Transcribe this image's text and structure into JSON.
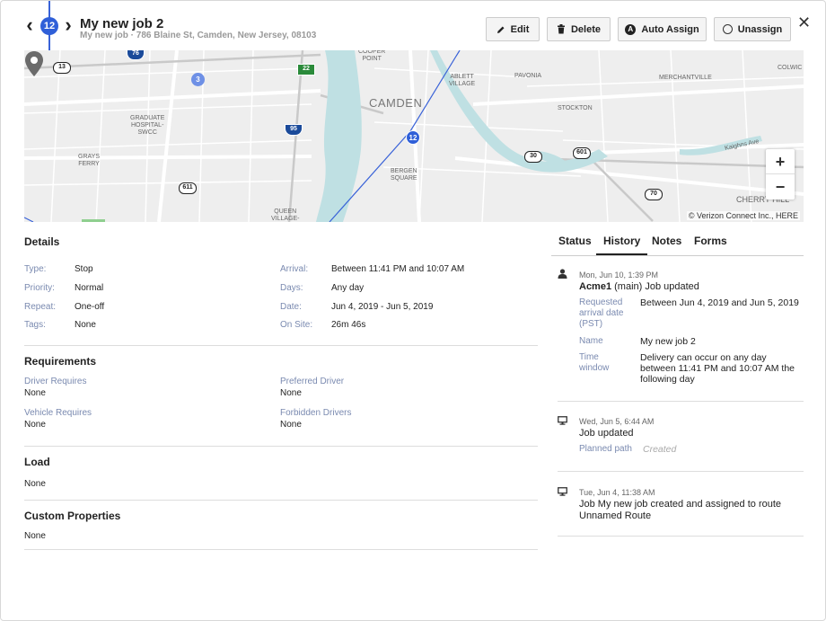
{
  "header": {
    "stop_number": "12",
    "title": "My new job 2",
    "subtitle": "My new job · 786 Blaine St, Camden, New Jersey, 08103",
    "edit_label": "Edit",
    "delete_label": "Delete",
    "auto_assign_label": "Auto Assign",
    "unassign_label": "Unassign",
    "auto_assign_icon_letter": "A",
    "close_glyph": "✕",
    "prev_glyph": "‹",
    "next_glyph": "›"
  },
  "map": {
    "labels": {
      "cooper_point": "COOPER\nPOINT",
      "ablett_village": "ABLETT\nVILLAGE",
      "pavonia": "PAVONIA",
      "merchantville": "MERCHANTVILLE",
      "colwick": "COLWIC",
      "graduate_hospital": "GRADUATE\nHOSPITAL-\nSWCC",
      "camden": "CAMDEN",
      "stockton": "STOCKTON",
      "grays_ferry": "GRAYS\nFERRY",
      "bergen_square": "BERGEN\nSQUARE",
      "kaighns_ave": "Kaighns Ave",
      "queen_village": "QUEEN\nVILLAGE-",
      "cherry_hill": "CHERRY HILL"
    },
    "shields": {
      "r13": "13",
      "r76": "76",
      "r22": "22",
      "r95": "95",
      "r30": "30",
      "r601": "601",
      "r611": "611",
      "r70": "70"
    },
    "marker_3": "3",
    "pin_number": "12",
    "zoom_in": "+",
    "zoom_out": "−",
    "attribution": "© Verizon Connect Inc., HERE"
  },
  "details": {
    "title": "Details",
    "left": [
      {
        "label": "Type:",
        "value": "Stop"
      },
      {
        "label": "Priority:",
        "value": "Normal"
      },
      {
        "label": "Repeat:",
        "value": "One-off"
      },
      {
        "label": "Tags:",
        "value": "None"
      }
    ],
    "right": [
      {
        "label": "Arrival:",
        "value": "Between 11:41 PM and 10:07 AM"
      },
      {
        "label": "Days:",
        "value": "Any day"
      },
      {
        "label": "Date:",
        "value": "Jun 4, 2019 - Jun 5, 2019"
      },
      {
        "label": "On Site:",
        "value": "26m 46s"
      }
    ]
  },
  "requirements": {
    "title": "Requirements",
    "driver_requires_label": "Driver Requires",
    "driver_requires_value": "None",
    "preferred_driver_label": "Preferred Driver",
    "preferred_driver_value": "None",
    "vehicle_requires_label": "Vehicle Requires",
    "vehicle_requires_value": "None",
    "forbidden_drivers_label": "Forbidden Drivers",
    "forbidden_drivers_value": "None"
  },
  "load": {
    "title": "Load",
    "value": "None"
  },
  "custom_properties": {
    "title": "Custom Properties",
    "value": "None"
  },
  "tabs": {
    "status": "Status",
    "history": "History",
    "notes": "Notes",
    "forms": "Forms",
    "active": "History"
  },
  "history": [
    {
      "icon": "person-icon",
      "time": "Mon, Jun 10, 1:39 PM",
      "actor": "Acme1",
      "actor_suffix": " (main) Job updated",
      "fields": [
        {
          "key": "Requested arrival date (PST)",
          "value": "Between Jun 4, 2019 and Jun 5, 2019"
        },
        {
          "key": "Name",
          "value": "My new job 2"
        },
        {
          "key": "Time window",
          "value": "Delivery can occur on any day between 11:41 PM and 10:07 AM the following day"
        }
      ]
    },
    {
      "icon": "monitor-icon",
      "time": "Wed, Jun 5, 6:44 AM",
      "text": "Job updated",
      "field_key": "Planned path",
      "field_value": "Created"
    },
    {
      "icon": "monitor-icon",
      "time": "Tue, Jun 4, 11:38 AM",
      "text": "Job My new job created and assigned to route Unnamed Route"
    }
  ],
  "colors": {
    "accent_blue": "#2f5fd8",
    "label_blue": "#7a8ab0"
  }
}
